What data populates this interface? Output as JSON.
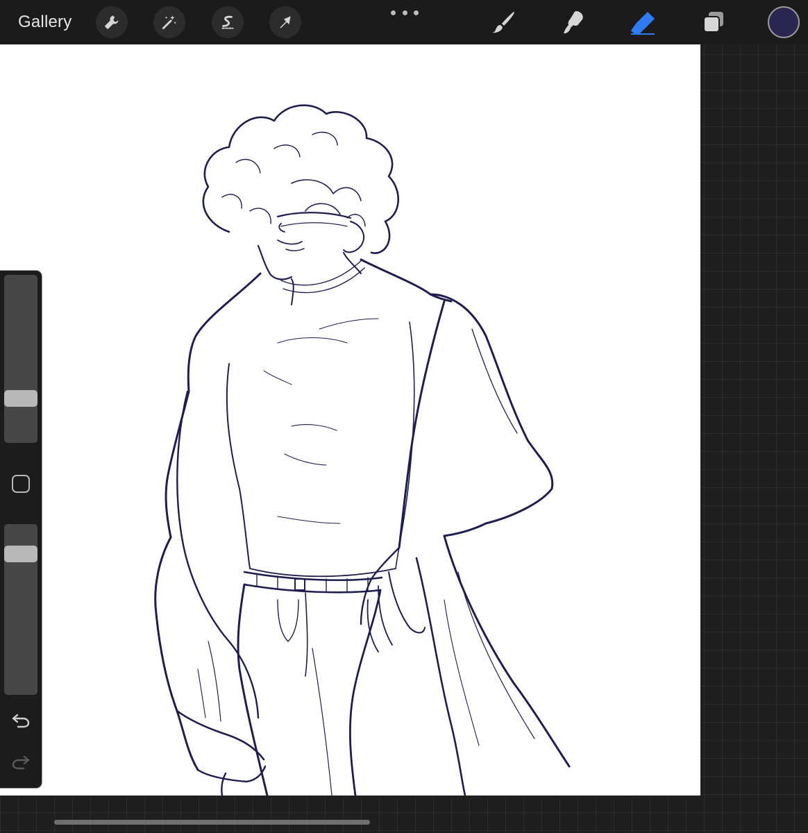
{
  "toolbar": {
    "gallery_label": "Gallery",
    "left_tools": [
      {
        "name": "actions",
        "icon": "wrench-icon"
      },
      {
        "name": "adjustments",
        "icon": "magic-wand-icon"
      },
      {
        "name": "selection",
        "icon": "selection-s-icon"
      },
      {
        "name": "transform",
        "icon": "arrow-cursor-icon"
      }
    ],
    "more_icon": "more-dots-icon",
    "right_tools": [
      {
        "name": "brush",
        "icon": "brush-icon",
        "active": false
      },
      {
        "name": "smudge",
        "icon": "smudge-icon",
        "active": false
      },
      {
        "name": "eraser",
        "icon": "eraser-icon",
        "active": true
      },
      {
        "name": "layers",
        "icon": "layers-icon",
        "active": false
      }
    ],
    "current_color": "#2a2650"
  },
  "sidebar": {
    "brush_size_level": 0.24,
    "opacity_level": 0.86,
    "modifier_icon": "square-modifier-icon",
    "undo_icon": "undo-icon",
    "redo_icon": "redo-icon"
  },
  "colors": {
    "accent": "#2f7bf5",
    "stroke": "#1f1d4d",
    "icon": "#d6d6d6"
  },
  "canvas": {
    "content": "line-art-sketch"
  }
}
